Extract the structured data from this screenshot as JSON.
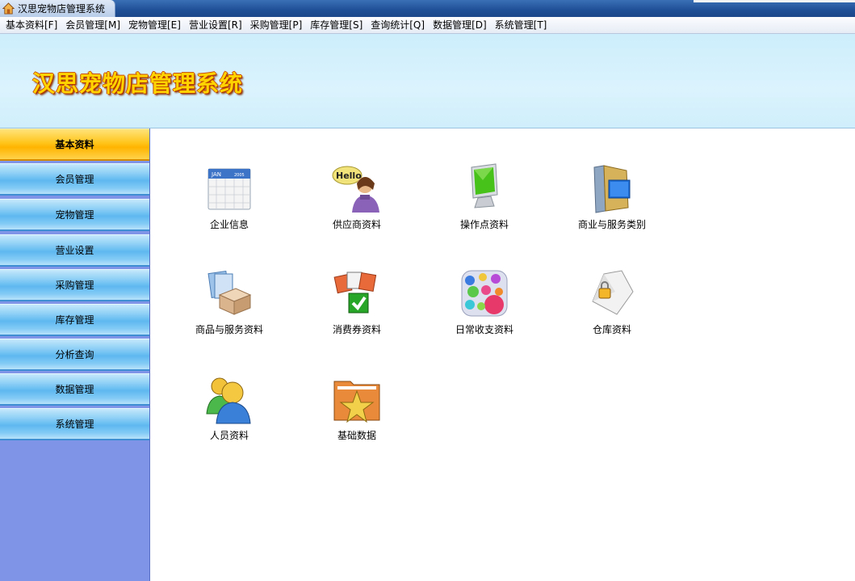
{
  "window": {
    "title": "汉思宠物店管理系统"
  },
  "menu": [
    {
      "label": "基本资料[F]"
    },
    {
      "label": "会员管理[M]"
    },
    {
      "label": "宠物管理[E]"
    },
    {
      "label": "营业设置[R]"
    },
    {
      "label": "采购管理[P]"
    },
    {
      "label": "库存管理[S]"
    },
    {
      "label": "查询统计[Q]"
    },
    {
      "label": "数据管理[D]"
    },
    {
      "label": "系统管理[T]"
    }
  ],
  "banner": {
    "title": "汉思宠物店管理系统"
  },
  "sidebar": {
    "active": "基本资料",
    "items": [
      {
        "label": "基本资料"
      },
      {
        "label": "会员管理"
      },
      {
        "label": "宠物管理"
      },
      {
        "label": "营业设置"
      },
      {
        "label": "采购管理"
      },
      {
        "label": "库存管理"
      },
      {
        "label": "分析查询"
      },
      {
        "label": "数据管理"
      },
      {
        "label": "系统管理"
      }
    ]
  },
  "tiles": [
    {
      "label": "企业信息",
      "icon": "calendar-icon"
    },
    {
      "label": "供应商资料",
      "icon": "hello-person-icon"
    },
    {
      "label": "操作点资料",
      "icon": "monitor-icon"
    },
    {
      "label": "商业与服务类别",
      "icon": "folder-blue-icon"
    },
    {
      "label": "商品与服务资料",
      "icon": "box-documents-icon"
    },
    {
      "label": "消费券资料",
      "icon": "coupon-check-icon"
    },
    {
      "label": "日常收支资料",
      "icon": "bubbles-icon"
    },
    {
      "label": "仓库资料",
      "icon": "bag-lock-icon"
    },
    {
      "label": "人员资料",
      "icon": "people-icon"
    },
    {
      "label": "基础数据",
      "icon": "folder-star-icon"
    }
  ],
  "calendar_icon_text": {
    "month": "JAN",
    "year": "2005"
  },
  "hello_icon_text": "Hello"
}
